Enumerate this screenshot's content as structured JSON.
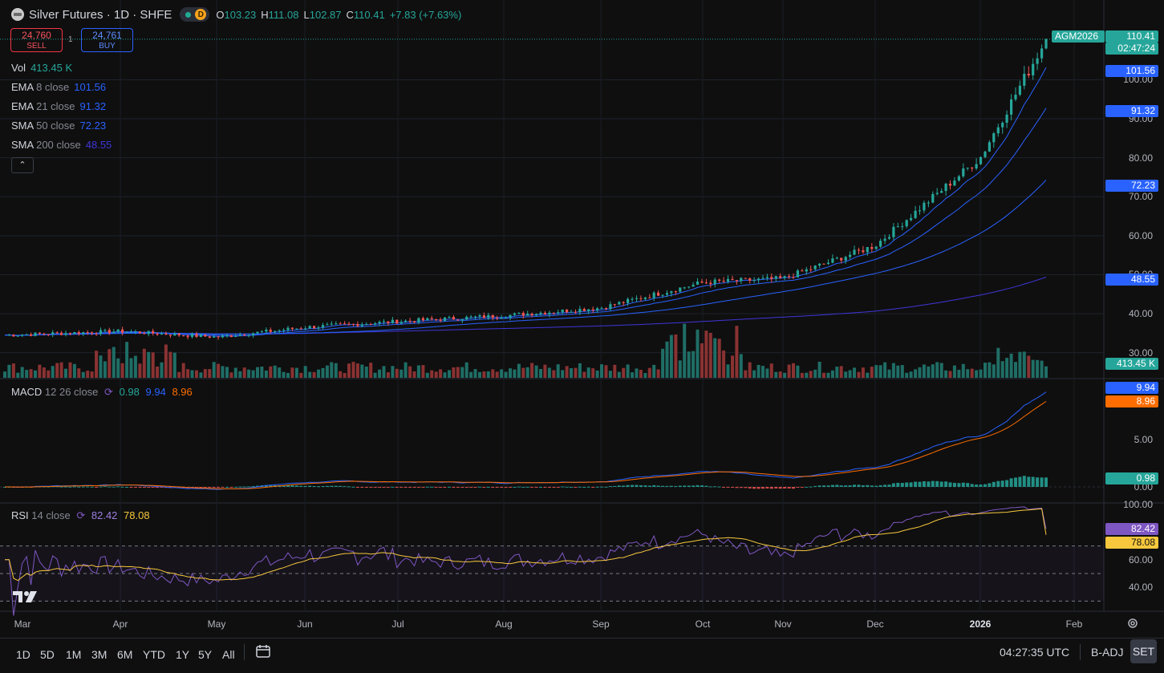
{
  "header": {
    "title": "Silver Futures · 1D · SHFE",
    "interval_badge": "D",
    "ohlc": [
      {
        "k": "O",
        "v": "103.23"
      },
      {
        "k": "H",
        "v": "111.08"
      },
      {
        "k": "L",
        "v": "102.87"
      },
      {
        "k": "C",
        "v": "110.41"
      },
      {
        "k": "",
        "v": "+7.83 (+7.63%)"
      }
    ]
  },
  "trade": {
    "sell_price": "24,760",
    "sell_label": "SELL",
    "buy_price": "24,761",
    "buy_label": "BUY",
    "quantity": "1"
  },
  "legend": {
    "vol": {
      "name": "Vol",
      "value": "413.45 K"
    },
    "indicators": [
      {
        "name": "EMA",
        "params": "8 close",
        "value": "101.56",
        "color": "#2962ff"
      },
      {
        "name": "EMA",
        "params": "21 close",
        "value": "91.32",
        "color": "#2962ff"
      },
      {
        "name": "SMA",
        "params": "50 close",
        "value": "72.23",
        "color": "#2962ff"
      },
      {
        "name": "SMA",
        "params": "200 close",
        "value": "48.55",
        "color": "#3f36d8"
      }
    ],
    "macd": {
      "name": "MACD",
      "params": "12 26 close",
      "hist": "0.98",
      "macd": "9.94",
      "signal": "8.96"
    },
    "rsi": {
      "name": "RSI",
      "params": "14 close",
      "rsi": "82.42",
      "ma": "78.08"
    }
  },
  "price_axis": [
    "100.00",
    "90.00",
    "80.00",
    "70.00",
    "60.00",
    "50.00",
    "40.00",
    "30.00"
  ],
  "macd_axis": [
    "5.00",
    "0.00"
  ],
  "rsi_axis": [
    "100.00",
    "60.00",
    "40.00"
  ],
  "tags": {
    "symbol": "AGM2026",
    "last": "110.41",
    "countdown": "02:47:24",
    "ema8": "101.56",
    "ema21": "91.32",
    "sma50": "72.23",
    "sma200": "48.55",
    "vol": "413.45 K",
    "macd": "9.94",
    "signal": "8.96",
    "hist": "0.98",
    "rsi": "82.42",
    "rsi_ma": "78.08"
  },
  "time_axis": [
    {
      "label": "Mar",
      "bold": false
    },
    {
      "label": "Apr",
      "bold": false
    },
    {
      "label": "May",
      "bold": false
    },
    {
      "label": "Jun",
      "bold": false
    },
    {
      "label": "Jul",
      "bold": false
    },
    {
      "label": "Aug",
      "bold": false
    },
    {
      "label": "Sep",
      "bold": false
    },
    {
      "label": "Oct",
      "bold": false
    },
    {
      "label": "Nov",
      "bold": false
    },
    {
      "label": "Dec",
      "bold": false
    },
    {
      "label": "2026",
      "bold": true
    },
    {
      "label": "Feb",
      "bold": false
    }
  ],
  "bottom_bar": {
    "ranges": [
      "1D",
      "5D",
      "1M",
      "3M",
      "6M",
      "YTD",
      "1Y",
      "5Y",
      "All"
    ],
    "clock": "04:27:35 UTC",
    "adjust": "B-ADJ",
    "session": "SET"
  },
  "colors": {
    "up": "#26a69a",
    "down": "#ef5350",
    "ema": "#2962ff",
    "sma200": "#3f36d8",
    "macd": "#2962ff",
    "signal": "#ff6d00",
    "rsi": "#7e57c2",
    "rsi_ma": "#f7c83d"
  },
  "chart_data": [
    {
      "type": "candlestick",
      "title": "Silver Futures · 1D · SHFE",
      "x_range": [
        "Mar",
        "Feb"
      ],
      "ylim": [
        27,
        112
      ],
      "price_points": [
        {
          "x": "Mar",
          "close": 34.5
        },
        {
          "x": "Apr",
          "close": 35.5
        },
        {
          "x": "May",
          "close": 34.0
        },
        {
          "x": "Jun",
          "close": 36.5
        },
        {
          "x": "Jul",
          "close": 38.0
        },
        {
          "x": "Aug",
          "close": 39.5
        },
        {
          "x": "Sep",
          "close": 41.5
        },
        {
          "x": "Oct",
          "close": 48.0
        },
        {
          "x": "Nov",
          "close": 49.0
        },
        {
          "x": "Dec",
          "close": 57.5
        },
        {
          "x": "2026",
          "close": 80.0
        },
        {
          "x": "last",
          "close": 110.41
        }
      ],
      "last": {
        "open": 103.23,
        "high": 111.08,
        "low": 102.87,
        "close": 110.41
      }
    },
    {
      "type": "line",
      "name": "MACD 12 26 close",
      "series": [
        {
          "name": "MACD",
          "last": 9.94
        },
        {
          "name": "Signal",
          "last": 8.96
        },
        {
          "name": "Histogram",
          "last": 0.98
        }
      ]
    },
    {
      "type": "line",
      "name": "RSI 14 close",
      "ylim": [
        25,
        100
      ],
      "bands": [
        70,
        50,
        30
      ],
      "series": [
        {
          "name": "RSI",
          "last": 82.42
        },
        {
          "name": "RSI MA",
          "last": 78.08
        }
      ]
    }
  ]
}
